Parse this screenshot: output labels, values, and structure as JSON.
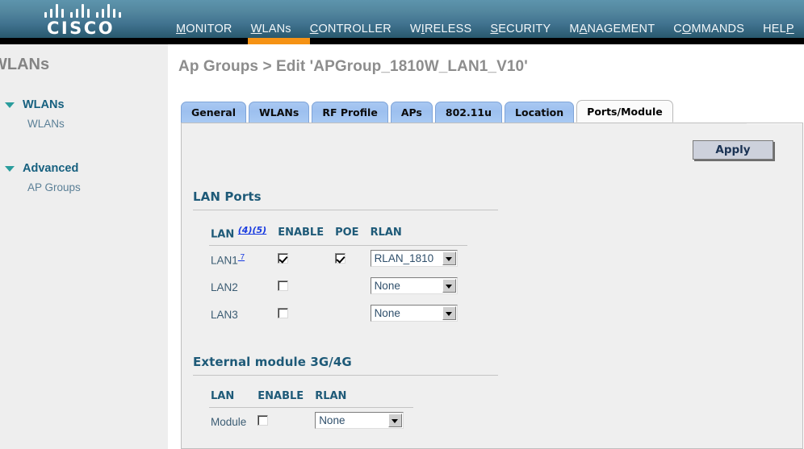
{
  "header": {
    "logo_word": "CISCO",
    "logo_alt": "cisco-logo",
    "nav": [
      {
        "pre": "",
        "key": "M",
        "post": "ONITOR",
        "active": false
      },
      {
        "pre": "",
        "key": "W",
        "post": "LANs",
        "active": true
      },
      {
        "pre": "",
        "key": "C",
        "post": "ONTROLLER",
        "active": false
      },
      {
        "pre": "W",
        "key": "I",
        "post": "RELESS",
        "active": false
      },
      {
        "pre": "",
        "key": "S",
        "post": "ECURITY",
        "active": false
      },
      {
        "pre": "M",
        "key": "A",
        "post": "NAGEMENT",
        "active": false
      },
      {
        "pre": "C",
        "key": "O",
        "post": "MMANDS",
        "active": false
      },
      {
        "pre": "HEL",
        "key": "P",
        "post": "",
        "active": false
      }
    ],
    "active_color": "#f59214"
  },
  "sidebar": {
    "title": "WLANs",
    "groups": [
      {
        "label": "WLANs",
        "items": [
          "WLANs"
        ]
      },
      {
        "label": "Advanced",
        "items": [
          "AP Groups"
        ]
      }
    ]
  },
  "main": {
    "page_title": "Ap Groups > Edit  'APGroup_1810W_LAN1_V10'",
    "tabs": [
      {
        "label": "General",
        "active": false
      },
      {
        "label": "WLANs",
        "active": false
      },
      {
        "label": "RF Profile",
        "active": false
      },
      {
        "label": "APs",
        "active": false
      },
      {
        "label": "802.11u",
        "active": false
      },
      {
        "label": "Location",
        "active": false
      },
      {
        "label": "Ports/Module",
        "active": true
      }
    ],
    "apply_label": "Apply",
    "lan_ports": {
      "title": "LAN Ports",
      "columns": [
        "LAN",
        "ENABLE",
        "POE",
        "RLAN"
      ],
      "lan_header_notes": "(4)(5)",
      "rows": [
        {
          "lan": "LAN1",
          "note": "7",
          "enable": true,
          "poe": true,
          "poe_present": true,
          "rlan": "RLAN_1810"
        },
        {
          "lan": "LAN2",
          "note": "",
          "enable": false,
          "poe": false,
          "poe_present": false,
          "rlan": "None"
        },
        {
          "lan": "LAN3",
          "note": "",
          "enable": false,
          "poe": false,
          "poe_present": false,
          "rlan": "None"
        }
      ]
    },
    "external_module": {
      "title": "External module 3G/4G",
      "columns": [
        "LAN",
        "ENABLE",
        "RLAN"
      ],
      "rows": [
        {
          "lan": "Module",
          "enable": false,
          "rlan": "None"
        }
      ]
    }
  }
}
